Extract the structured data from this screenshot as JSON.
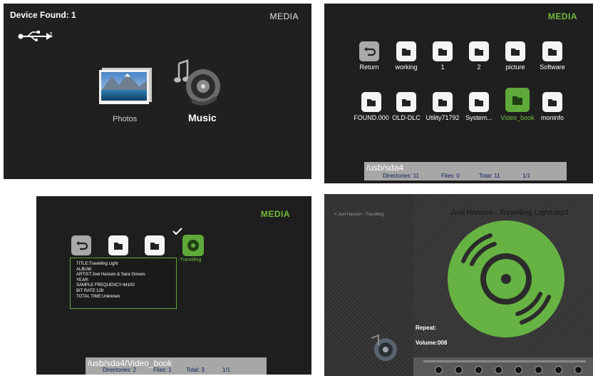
{
  "panel1": {
    "title": "Device Found: 1",
    "media": "MEDIA",
    "usb_count": "1",
    "photos_label": "Photos",
    "music_label": "Music"
  },
  "panel2": {
    "media": "MEDIA",
    "folders_row1": [
      "Return",
      "working",
      "1",
      "2",
      "picture",
      "Software"
    ],
    "folders_row2": [
      "FOUND.000",
      "OLD-DLC",
      "Utility71792",
      "System...",
      "Video_book",
      "moninfo"
    ],
    "selected": "Video_book",
    "status": {
      "path": "/usb/sda4",
      "directories": "Directories: 11",
      "files": "Files: 0",
      "total": "Total: 11",
      "page": "1/1"
    }
  },
  "panel3": {
    "media": "MEDIA",
    "selected_label": "-Travelling",
    "info": {
      "title": "TITLE:Travelling Light",
      "album": "ALBUM:",
      "artist": "ARTIST:Joel Hanson & Sara Groves",
      "year": "YEAR:",
      "sample": "SAMPLE FREQUENCY:44100",
      "bitrate": "BIT RATE:128",
      "total_time": "TOTAL TIME:Unknown"
    },
    "status": {
      "path": "/usb/sda4/Video_book",
      "directories": "Directories: 2",
      "files": "Files: 1",
      "total": "Total: 3",
      "page": "1/1"
    }
  },
  "panel4": {
    "breadcrumb": "<  Joel Hanson - Travelling",
    "song": "Joel Hanson - Travelling Light.mp3",
    "repeat": "Repeat:",
    "volume": "Volume:008",
    "progress": 0
  },
  "colors": {
    "accent": "#5fa83a",
    "accent_text": "#72b93b",
    "statusbar": "#a7a7a7"
  }
}
